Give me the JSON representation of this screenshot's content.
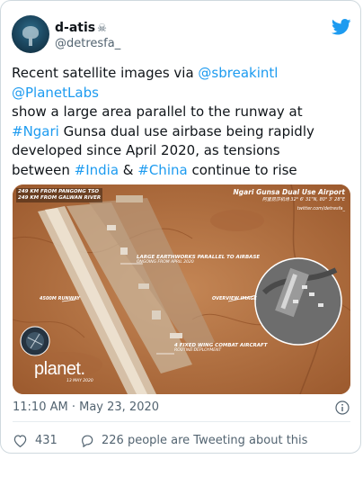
{
  "author": {
    "display_name": "d-atis",
    "badge": "☠",
    "handle": "@detresfa_"
  },
  "tweet": {
    "lines": [
      {
        "parts": [
          {
            "text": "Recent satellite images via ",
            "link": false
          },
          {
            "text": "@sbreakintl",
            "link": true
          }
        ]
      },
      {
        "parts": [
          {
            "text": "@PlanetLabs",
            "link": true
          }
        ]
      },
      {
        "parts": [
          {
            "text": "show a large area parallel to the runway at",
            "link": false
          }
        ]
      },
      {
        "parts": [
          {
            "text": "#Ngari",
            "link": true
          },
          {
            "text": " Gunsa dual use airbase being rapidly",
            "link": false
          }
        ]
      },
      {
        "parts": [
          {
            "text": "developed since April 2020, as tensions",
            "link": false
          }
        ]
      },
      {
        "parts": [
          {
            "text": "between ",
            "link": false
          },
          {
            "text": "#India",
            "link": true
          },
          {
            "text": " & ",
            "link": false
          },
          {
            "text": "#China",
            "link": true
          },
          {
            "text": " continue to rise",
            "link": false
          }
        ]
      }
    ]
  },
  "image": {
    "distance_1": "249 KM FROM PANGONG TSO",
    "distance_2": "249 KM FROM GALWAN RIVER",
    "title": "Ngari Gunsa Dual Use Airport",
    "coords": "阿里昆莎机场  32° 6' 31\"N, 80° 3' 28\"E",
    "credit": "twitter.com/detresfa_",
    "earthworks": "LARGE EARTHWORKS PARALLEL TO AIRBASE",
    "earthworks_sub": "ONGOING FROM APRIL 2020",
    "runway": "4500M RUNWAY",
    "overview": "OVERVIEW IMAGE",
    "aircraft": "4 FIXED WING COMBAT AIRCRAFT",
    "aircraft_sub": "ROUTINE DEPLOYMENT",
    "planet": "planet.",
    "planet_date": "13 MAY 2020"
  },
  "timestamp": "11:10 AM · May 23, 2020",
  "likes": "431",
  "replies_text": "226 people are Tweeting about this",
  "colors": {
    "link": "#1d9bf0",
    "muted": "#536471",
    "like_accent": "#f91880"
  }
}
